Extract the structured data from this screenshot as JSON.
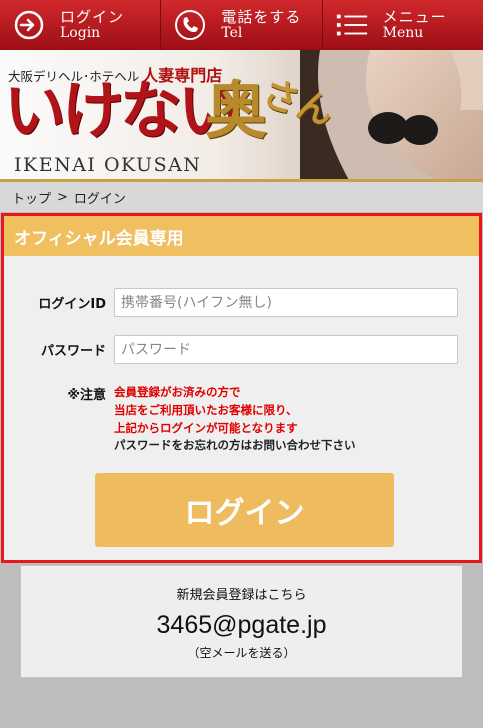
{
  "nav": [
    {
      "jp": "ログイン",
      "en": "Login",
      "icon": "login-icon"
    },
    {
      "jp": "電話をする",
      "en": "Tel",
      "icon": "phone-icon"
    },
    {
      "jp": "メニュー",
      "en": "Menu",
      "icon": "menu-icon"
    }
  ],
  "banner": {
    "subtitle_prefix": "大阪デリヘル･ホテヘル",
    "subtitle_strong": "人妻専門店",
    "title_main": "いけない",
    "title_kanji": "奥",
    "title_kana": "さん",
    "roman": "IKENAI OKUSAN"
  },
  "breadcrumb": {
    "home": "トップ",
    "separator": ">",
    "current": "ログイン"
  },
  "login": {
    "heading": "オフィシャル会員専用",
    "id_label": "ログインID",
    "id_placeholder": "携帯番号(ハイフン無し)",
    "pw_label": "パスワード",
    "pw_placeholder": "パスワード",
    "notice_label": "※注意",
    "notice_red_1": "会員登録がお済みの方で",
    "notice_red_2": "当店をご利用頂いたお客様に限り、",
    "notice_red_3": "上記からログインが可能となります",
    "notice_black": "パスワードをお忘れの方はお問い合わせ下さい",
    "button": "ログイン"
  },
  "register": {
    "label": "新規会員登録はこちら",
    "email": "3465@pgate.jp",
    "hint": "（空メールを送る）"
  },
  "colors": {
    "nav_red": "#c21e23",
    "panel_border": "#e8161d",
    "gold": "#eebc5e",
    "notice_red": "#e00000"
  }
}
